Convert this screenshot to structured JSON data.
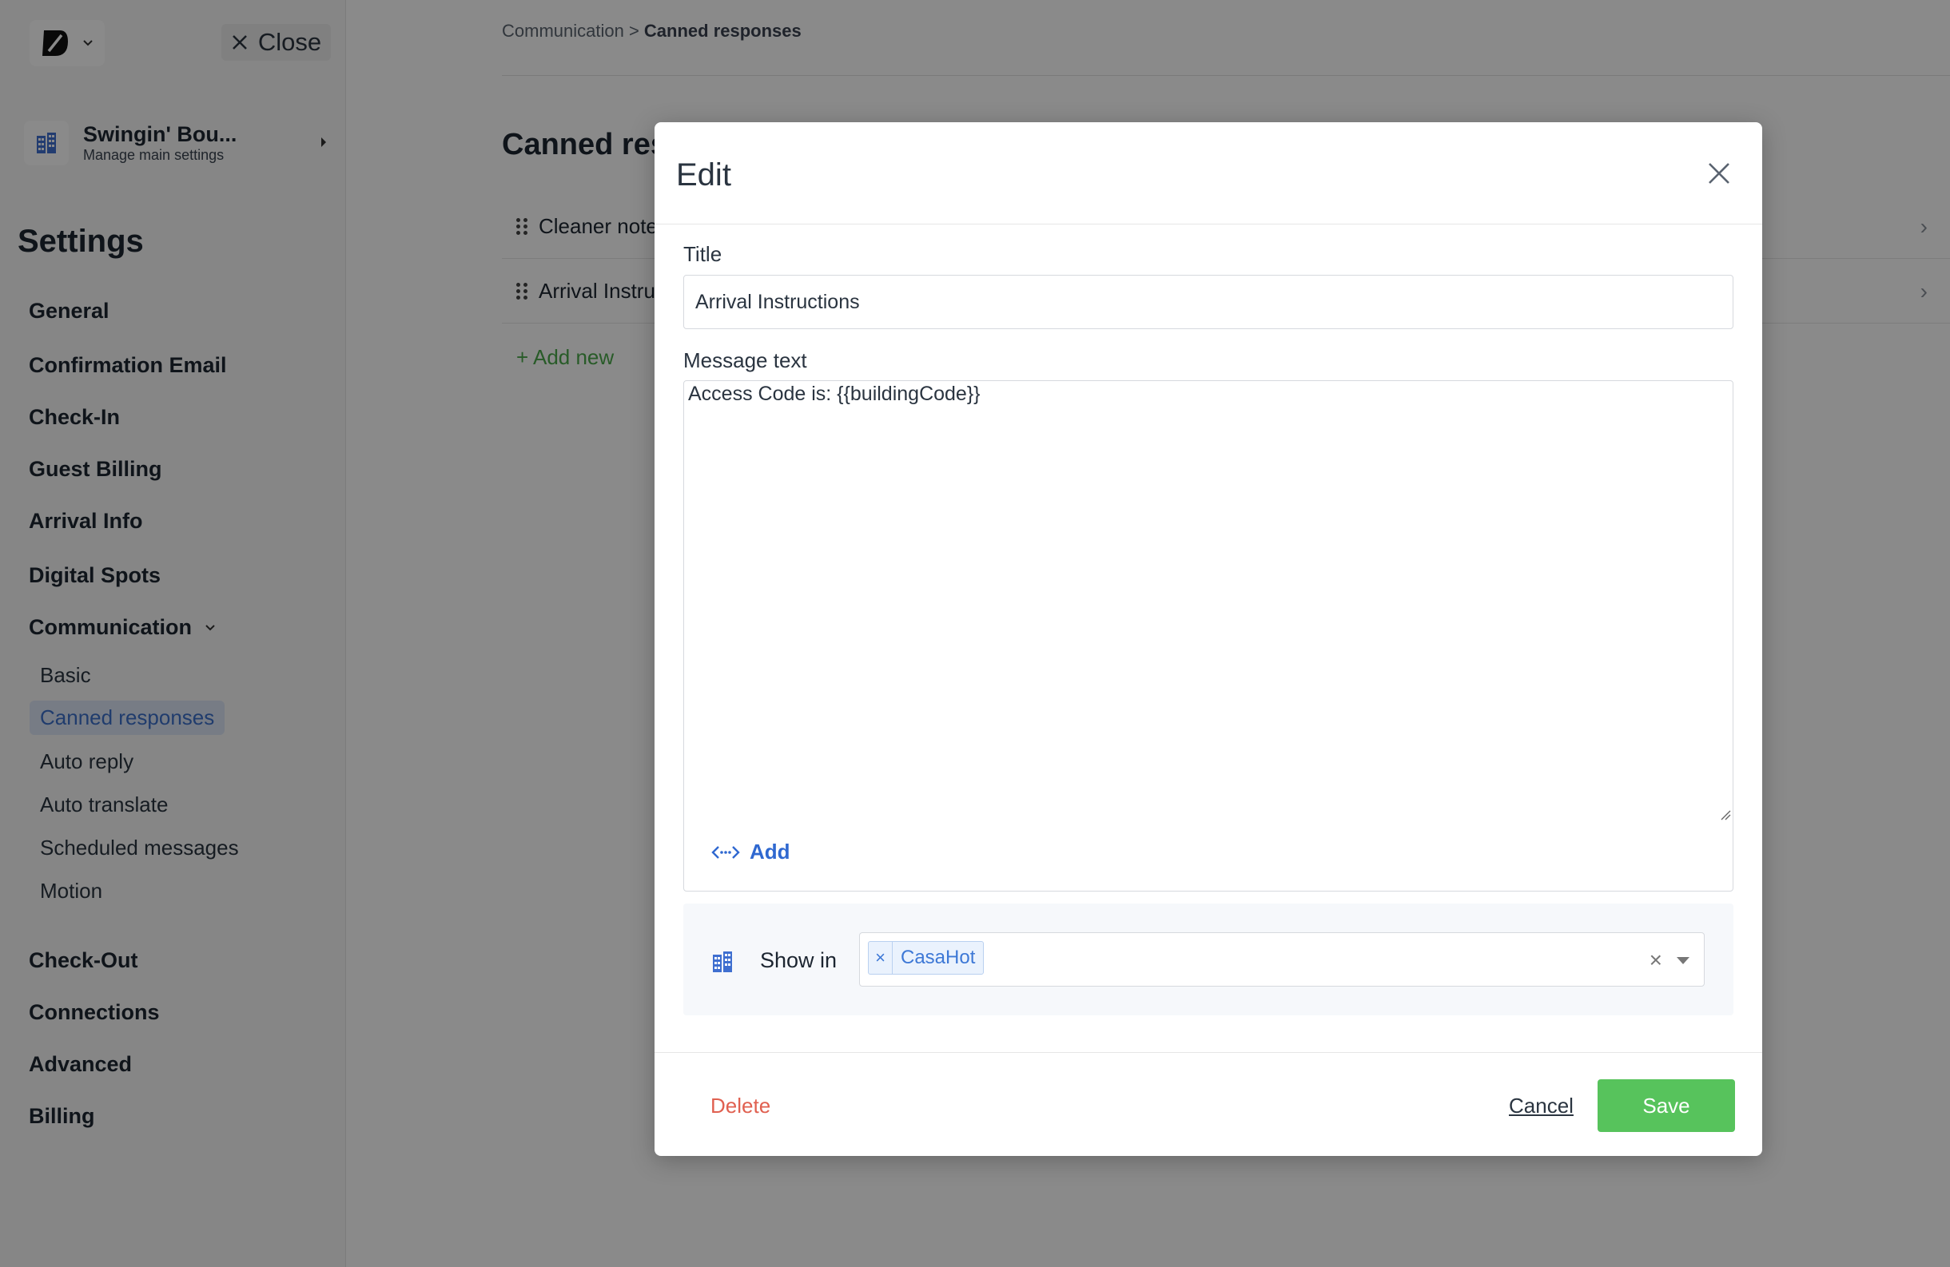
{
  "sidebar": {
    "close_label": "Close",
    "property": {
      "name": "Swingin' Bou...",
      "subtitle": "Manage main settings"
    },
    "settings_title": "Settings",
    "items": [
      {
        "label": "General"
      },
      {
        "label": "Confirmation Email"
      },
      {
        "label": "Check-In"
      },
      {
        "label": "Guest Billing"
      },
      {
        "label": "Arrival Info"
      },
      {
        "label": "Digital Spots"
      },
      {
        "label": "Communication"
      },
      {
        "label": "Check-Out"
      },
      {
        "label": "Connections"
      },
      {
        "label": "Advanced"
      },
      {
        "label": "Billing"
      }
    ],
    "communication_sub": [
      {
        "label": "Basic"
      },
      {
        "label": "Canned responses",
        "active": true
      },
      {
        "label": "Auto reply"
      },
      {
        "label": "Auto translate"
      },
      {
        "label": "Scheduled messages"
      },
      {
        "label": "Motion"
      }
    ]
  },
  "main": {
    "breadcrumb_parent": "Communication",
    "breadcrumb_sep": " > ",
    "breadcrumb_current": "Canned responses",
    "page_title": "Canned res",
    "rows": [
      {
        "label": "Cleaner note"
      },
      {
        "label": "Arrival Instru"
      }
    ],
    "add_new": "+ Add new"
  },
  "modal": {
    "title": "Edit",
    "title_field_label": "Title",
    "title_value": "Arrival Instructions",
    "message_label": "Message text",
    "message_value": "Access Code is: {{buildingCode}}",
    "add_variable_label": "Add",
    "show_in_label": "Show in",
    "show_in_tags": [
      {
        "label": "CasaHot"
      }
    ],
    "delete_label": "Delete",
    "cancel_label": "Cancel",
    "save_label": "Save"
  },
  "colors": {
    "accent": "#2f68d0",
    "save": "#57c35c",
    "delete": "#e06050",
    "add_new": "#4aa84a"
  },
  "icons": {
    "logo": "brand-logo-icon",
    "close": "close-icon",
    "building": "building-icon",
    "variable": "code-variable-icon",
    "drag": "drag-handle-icon",
    "chevron": "chevron-right-icon"
  }
}
